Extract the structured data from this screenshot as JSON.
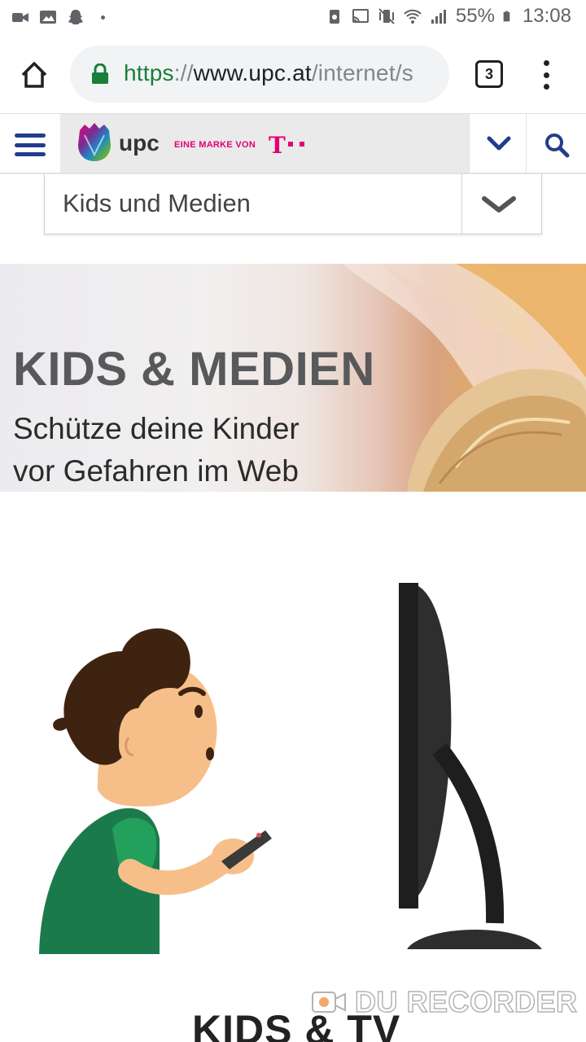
{
  "status_bar": {
    "battery_percent": "55%",
    "time": "13:08",
    "icons_left": [
      "video-recorder-icon",
      "image-icon",
      "snapchat-icon",
      "notification-dot-icon"
    ],
    "icons_right": [
      "recycle-icon",
      "cast-icon",
      "vibrate-mute-icon",
      "wifi-icon",
      "signal-icon",
      "battery-icon"
    ]
  },
  "browser": {
    "url_scheme": "https",
    "url_separator": "://",
    "url_host": "www.upc.at",
    "url_path": "/internet/s",
    "tab_count": "3",
    "accent_color": "#188038"
  },
  "site_header": {
    "brand_name": "upc",
    "brand_tagline": "EINE MARKE VON",
    "telekom_mark": "T",
    "brand_color": "#e20074",
    "nav_color": "#223e8a"
  },
  "section_select": {
    "selected": "Kids und Medien"
  },
  "hero": {
    "title": "KIDS & MEDIEN",
    "subtitle_line1": "Schütze deine Kinder",
    "subtitle_line2": "vor Gefahren im Web"
  },
  "section": {
    "title": "KIDS & TV"
  },
  "watermark": {
    "text": "DU RECORDER"
  }
}
